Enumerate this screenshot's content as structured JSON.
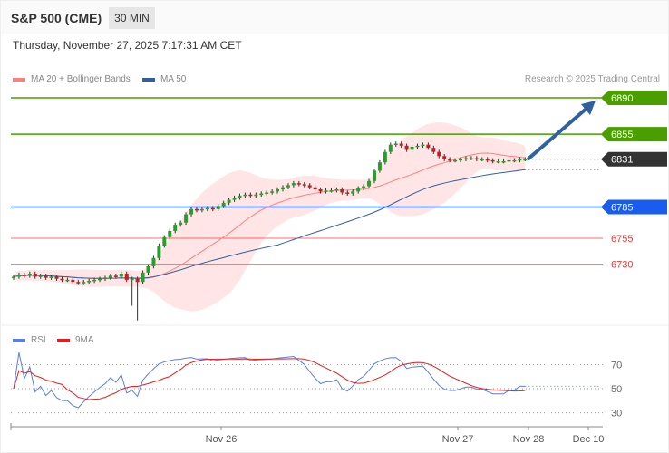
{
  "header": {
    "title": "S&P 500 (CME)",
    "timeframe": "30 MIN"
  },
  "datetime": "Thursday, November 27, 2025 7:17:31 AM CET",
  "legend": {
    "ma20": "MA 20 + Bollinger Bands",
    "ma50": "MA 50",
    "rsi": "RSI",
    "rsi_ma": "9MA"
  },
  "credit": "Research © 2025 Trading Central",
  "colors": {
    "resistance": "#4a9e00",
    "current": "#333333",
    "pivot": "#1a5cf0",
    "support": "#ff3030",
    "ma20": "#ff8080",
    "ma50": "#3060a0",
    "up": "#2a9e2a",
    "down": "#c02020",
    "rsi": "#5b7fe0",
    "rsi_ma": "#e02020"
  },
  "levels": [
    {
      "value": 6890,
      "label": "6890",
      "type": "resistance"
    },
    {
      "value": 6855,
      "label": "6855",
      "type": "resistance"
    },
    {
      "value": 6831,
      "label": "6831",
      "type": "current"
    },
    {
      "value": 6785,
      "label": "6785",
      "type": "pivot"
    },
    {
      "value": 6755,
      "label": "6755",
      "type": "support"
    },
    {
      "value": 6730,
      "label": "6730",
      "type": "support"
    }
  ],
  "chart_data": {
    "type": "candlestick",
    "closes": [
      6718,
      6720,
      6719,
      6721,
      6718,
      6719,
      6717,
      6718,
      6716,
      6715,
      6715,
      6713,
      6712,
      6713,
      6714,
      6715,
      6716,
      6717,
      6719,
      6718,
      6721,
      6715,
      6716,
      6713,
      6722,
      6728,
      6736,
      6748,
      6756,
      6762,
      6768,
      6770,
      6778,
      6783,
      6782,
      6783,
      6784,
      6783,
      6786,
      6789,
      6792,
      6794,
      6796,
      6797,
      6796,
      6797,
      6798,
      6799,
      6800,
      6802,
      6804,
      6806,
      6808,
      6807,
      6806,
      6804,
      6802,
      6800,
      6801,
      6801,
      6802,
      6799,
      6798,
      6800,
      6803,
      6805,
      6810,
      6820,
      6828,
      6838,
      6845,
      6846,
      6844,
      6840,
      6843,
      6844,
      6845,
      6842,
      6838,
      6834,
      6831,
      6830,
      6830,
      6831,
      6832,
      6832,
      6831,
      6831,
      6830,
      6829,
      6829,
      6829,
      6830,
      6830,
      6831,
      6831
    ],
    "long_wicks": {
      "22": 6690,
      "23": 6676
    },
    "rsi_ticks": [
      70,
      50,
      30
    ],
    "x_labels": [
      {
        "label": "Nov 26"
      },
      {
        "label": "Nov 27"
      },
      {
        "label": "Nov 28"
      },
      {
        "label": "Dec 10"
      }
    ],
    "target": 6890
  }
}
